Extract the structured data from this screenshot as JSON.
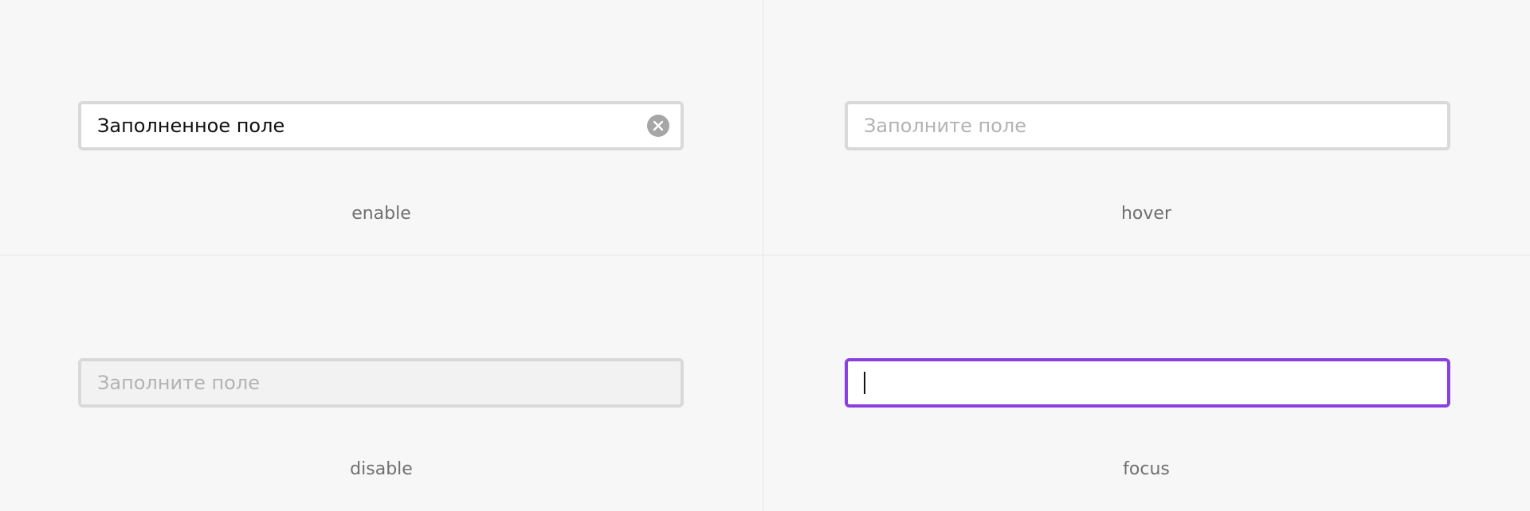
{
  "states": {
    "enable": {
      "label": "enable",
      "value": "Заполненное поле",
      "clear_icon": "close-circle-icon"
    },
    "hover": {
      "label": "hover",
      "placeholder": "Заполните поле"
    },
    "disable": {
      "label": "disable",
      "placeholder": "Заполните поле"
    },
    "focus": {
      "label": "focus",
      "value": ""
    }
  },
  "colors": {
    "background": "#f7f7f7",
    "border": "#d9d9d9",
    "focus_border": "#8a3fe0",
    "disabled_bg": "#f2f2f2",
    "placeholder": "#b3b3b3",
    "label": "#707070",
    "clear_icon_bg": "#a6a6a6"
  }
}
